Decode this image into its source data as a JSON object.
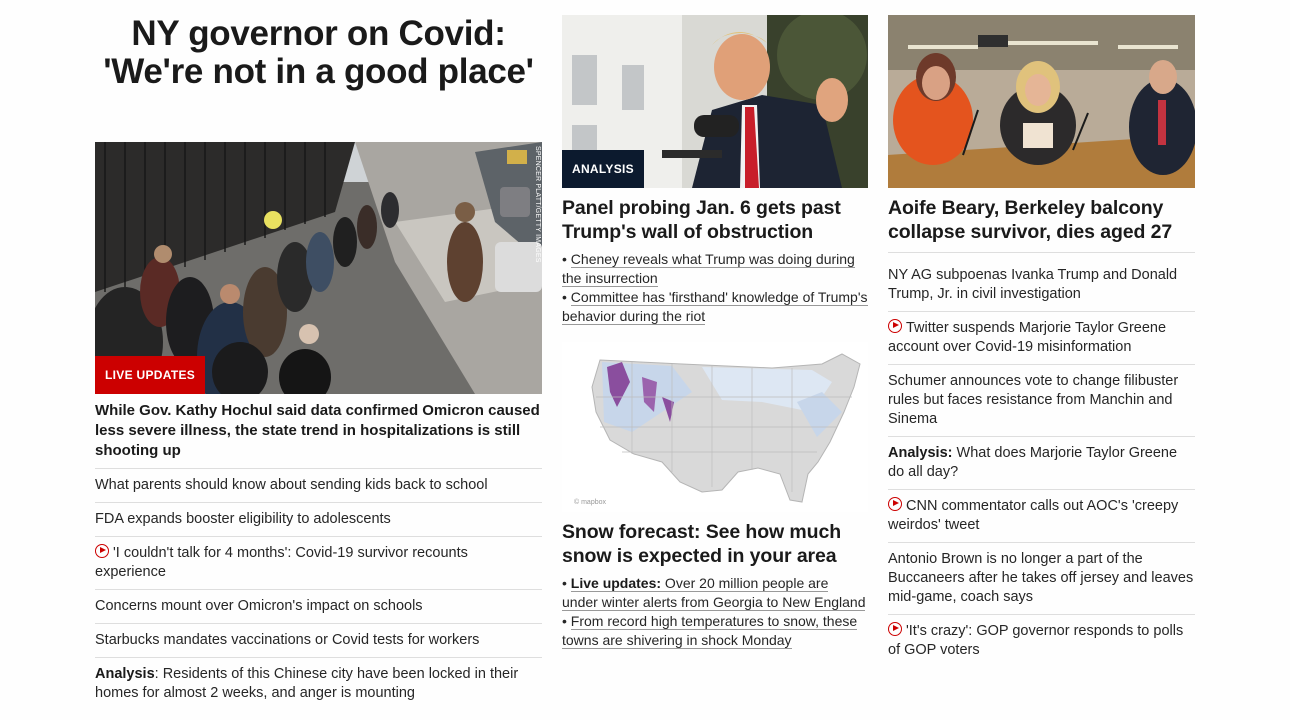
{
  "col1": {
    "headline": "NY governor on Covid: 'We're not in a good place'",
    "photo_badge": "LIVE UPDATES",
    "photo_credit": "SPENCER PLATT/GETTY IMAGES",
    "lede": "While Gov. Kathy Hochul said data confirmed Omicron caused less severe illness, the state trend in hospitalizations is still shooting up",
    "items": [
      {
        "text": "What parents should know about sending kids back to school"
      },
      {
        "text": "FDA expands booster eligibility to adolescents"
      },
      {
        "video": true,
        "text": "'I couldn't talk for 4 months': Covid-19 survivor recounts experience"
      },
      {
        "text": "Concerns mount over Omicron's impact on schools"
      },
      {
        "text": "Starbucks mandates vaccinations or Covid tests for workers"
      },
      {
        "prefix": "Analysis",
        "text": ": Residents of this Chinese city have been locked in their homes for almost 2 weeks, and anger is mounting"
      }
    ]
  },
  "col2": {
    "card1": {
      "badge": "ANALYSIS",
      "title": "Panel probing Jan. 6 gets past Trump's wall of obstruction",
      "bullets": [
        {
          "text": "Cheney reveals what Trump was doing during the insurrection"
        },
        {
          "text": "Committee has 'firsthand' knowledge of Trump's behavior during the riot"
        }
      ]
    },
    "card2": {
      "map_brand": "© mapbox",
      "title": "Snow forecast: See how much snow is expected in your area",
      "bullets": [
        {
          "prefix": "Live updates:",
          "text": " Over 20 million people are under winter alerts from Georgia to New England"
        },
        {
          "text": "From record high temperatures to snow, these towns are shivering in shock Monday"
        }
      ]
    }
  },
  "col3": {
    "title": "Aoife Beary, Berkeley balcony collapse survivor, dies aged 27",
    "items": [
      {
        "text": "NY AG subpoenas Ivanka Trump and Donald Trump, Jr. in civil investigation"
      },
      {
        "video": true,
        "text": "Twitter suspends Marjorie Taylor Greene account over Covid-19 misinformation"
      },
      {
        "text": "Schumer announces vote to change filibuster rules but faces resistance from Manchin and Sinema"
      },
      {
        "prefix": "Analysis:",
        "text": " What does Marjorie Taylor Greene do all day?"
      },
      {
        "video": true,
        "text": "CNN commentator calls out AOC's 'creepy weirdos' tweet"
      },
      {
        "text": "Antonio Brown is no longer a part of the Buccaneers after he takes off jersey and leaves mid-game, coach says"
      },
      {
        "video": true,
        "text": "'It's crazy': GOP governor responds to polls of GOP voters"
      }
    ]
  },
  "colors": {
    "live_red": "#cc0000",
    "analysis_navy": "#0c1a2e",
    "divider": "#dedede"
  }
}
